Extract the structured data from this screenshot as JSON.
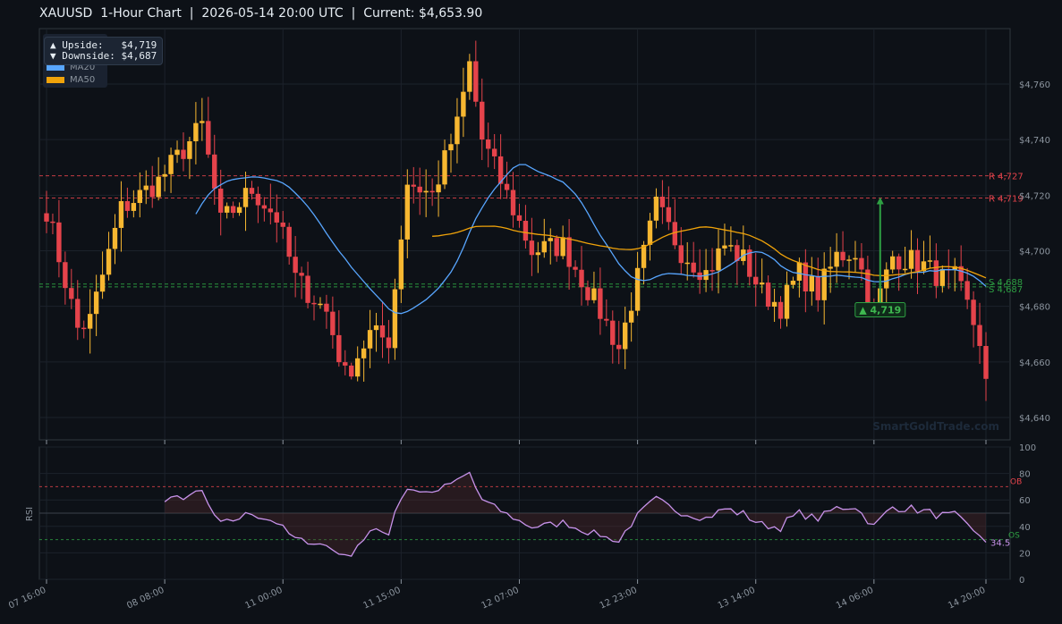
{
  "title": "XAUUSD  1-Hour Chart  |  2026-05-14 20:00 UTC  |  Current: $4,653.90",
  "watermark": "SmartGoldTrade.com",
  "annotation": {
    "upside": "▲ Upside:   $4,719",
    "downside": "▼ Downside: $4,687"
  },
  "legend": [
    {
      "label": "MA20",
      "color": "#58a6ff"
    },
    {
      "label": "MA50",
      "color": "#f0a30a"
    }
  ],
  "colors": {
    "up": "#f7b731",
    "down": "#e5434b",
    "resistance": "#e5434b",
    "support": "#2ea043",
    "rsi": "#c792ea"
  },
  "chart_data": [
    {
      "type": "candlestick",
      "ylabel": "",
      "ylim": [
        4625,
        4780
      ],
      "yticks": [
        4640,
        4660,
        4680,
        4700,
        4720,
        4740,
        4760
      ],
      "ytick_labels": [
        "$4,640",
        "$4,660",
        "$4,680",
        "$4,700",
        "$4,720",
        "$4,740",
        "$4,760"
      ],
      "xticks": [
        0,
        19,
        38,
        57,
        76,
        95,
        114,
        133,
        151
      ],
      "xtick_labels": [
        "07 16:00",
        "08 08:00",
        "11 00:00",
        "11 15:00",
        "12 07:00",
        "12 23:00",
        "13 14:00",
        "14 06:00",
        "14 20:00"
      ],
      "resistance_levels": [
        {
          "value": 4727,
          "label": "R 4,727"
        },
        {
          "value": 4719,
          "label": "R 4,719"
        }
      ],
      "support_levels": [
        {
          "value": 4688,
          "label": "S 4,688"
        },
        {
          "value": 4687,
          "label": "S 4,687"
        }
      ],
      "target_arrow": {
        "label": "▲ 4,719",
        "index": 134,
        "from": 4681,
        "to": 4719
      },
      "grid": true,
      "ohlc_checkpoints": [
        [
          0,
          4715
        ],
        [
          5,
          4672
        ],
        [
          7,
          4675
        ],
        [
          12,
          4715
        ],
        [
          18,
          4725
        ],
        [
          25,
          4745
        ],
        [
          28,
          4710
        ],
        [
          33,
          4722
        ],
        [
          37,
          4712
        ],
        [
          40,
          4690
        ],
        [
          45,
          4678
        ],
        [
          48,
          4655
        ],
        [
          52,
          4670
        ],
        [
          55,
          4668
        ],
        [
          58,
          4725
        ],
        [
          62,
          4720
        ],
        [
          66,
          4745
        ],
        [
          68,
          4767
        ],
        [
          70,
          4740
        ],
        [
          75,
          4715
        ],
        [
          78,
          4700
        ],
        [
          83,
          4702
        ],
        [
          86,
          4690
        ],
        [
          89,
          4678
        ],
        [
          92,
          4665
        ],
        [
          95,
          4690
        ],
        [
          98,
          4716
        ],
        [
          102,
          4700
        ],
        [
          106,
          4692
        ],
        [
          109,
          4702
        ],
        [
          112,
          4697
        ],
        [
          115,
          4685
        ],
        [
          118,
          4680
        ],
        [
          121,
          4692
        ],
        [
          124,
          4685
        ],
        [
          127,
          4698
        ],
        [
          130,
          4700
        ],
        [
          133,
          4678
        ],
        [
          136,
          4698
        ],
        [
          140,
          4696
        ],
        [
          144,
          4690
        ],
        [
          146,
          4690
        ],
        [
          148,
          4680
        ],
        [
          150,
          4668
        ],
        [
          151,
          4653.9
        ]
      ],
      "ma20_start": 24,
      "ma50_start": 62
    },
    {
      "type": "line",
      "ylabel": "RSI",
      "ylim": [
        0,
        100
      ],
      "yticks": [
        0,
        20,
        40,
        60,
        80,
        100
      ],
      "overbought": {
        "value": 70,
        "label": "OB"
      },
      "oversold": {
        "value": 30,
        "label": "OS"
      },
      "last_value_label": "34.5",
      "rsi_start": 19
    }
  ]
}
